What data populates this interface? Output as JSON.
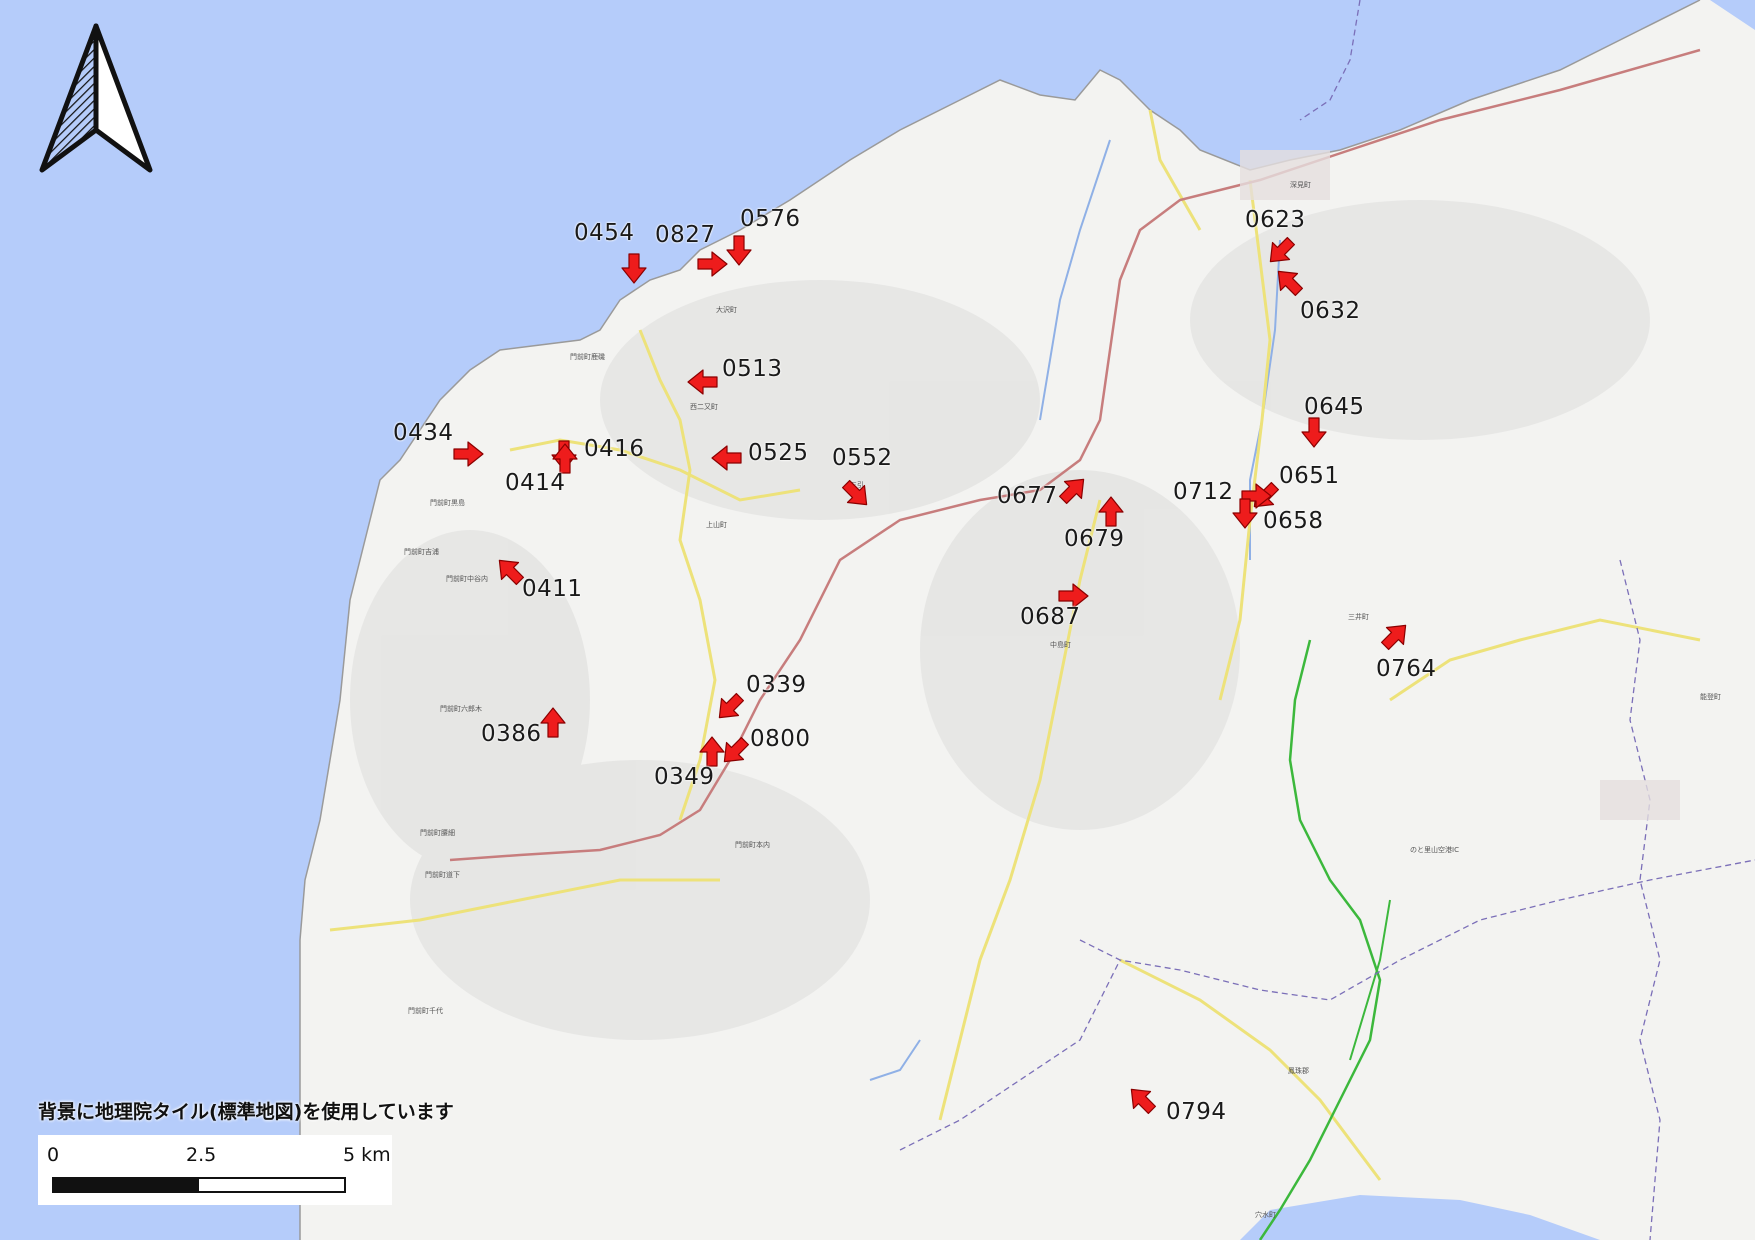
{
  "attribution": "背景に地理院タイル(標準地図)を使用しています",
  "scale_bar": {
    "tick_0": "0",
    "tick_mid": "2.5",
    "tick_max": "5 km"
  },
  "colors": {
    "sea": "#b5ccfa",
    "land": "#f3f3f1",
    "marker": "#ee1c1c",
    "road_yellow": "#ede27a",
    "expressway": "#3cb83c",
    "national_road": "#c77d7d"
  },
  "markers": [
    {
      "id": "0454",
      "direction": "down"
    },
    {
      "id": "0827",
      "direction": "right"
    },
    {
      "id": "0576",
      "direction": "down"
    },
    {
      "id": "0513",
      "direction": "left"
    },
    {
      "id": "0434",
      "direction": "right"
    },
    {
      "id": "0416",
      "direction": "down"
    },
    {
      "id": "0414",
      "direction": "up"
    },
    {
      "id": "0525",
      "direction": "left"
    },
    {
      "id": "0552",
      "direction": "down-right"
    },
    {
      "id": "0411",
      "direction": "up-left"
    },
    {
      "id": "0339",
      "direction": "down-left"
    },
    {
      "id": "0800",
      "direction": "down-left"
    },
    {
      "id": "0349",
      "direction": "up"
    },
    {
      "id": "0386",
      "direction": "up"
    },
    {
      "id": "0623",
      "direction": "down-left"
    },
    {
      "id": "0632",
      "direction": "up-left"
    },
    {
      "id": "0645",
      "direction": "down"
    },
    {
      "id": "0651",
      "direction": "down-left"
    },
    {
      "id": "0712",
      "direction": "right"
    },
    {
      "id": "0658",
      "direction": "down"
    },
    {
      "id": "0677",
      "direction": "up-right"
    },
    {
      "id": "0679",
      "direction": "up"
    },
    {
      "id": "0687",
      "direction": "right"
    },
    {
      "id": "0764",
      "direction": "up-right"
    },
    {
      "id": "0794",
      "direction": "up-left"
    }
  ],
  "place_labels": [
    "門前町鹿磯",
    "門前町道下",
    "門前町黒島",
    "穴水町",
    "能登町",
    "鳳珠郡",
    "三井町",
    "のと里山空港IC",
    "上山町",
    "大沢町",
    "西二又町",
    "深見町",
    "中島町",
    "三引",
    "門前町千代",
    "門前町腰細",
    "門前町中谷内",
    "門前町吉浦",
    "門前町六郎木",
    "門前町本内"
  ]
}
